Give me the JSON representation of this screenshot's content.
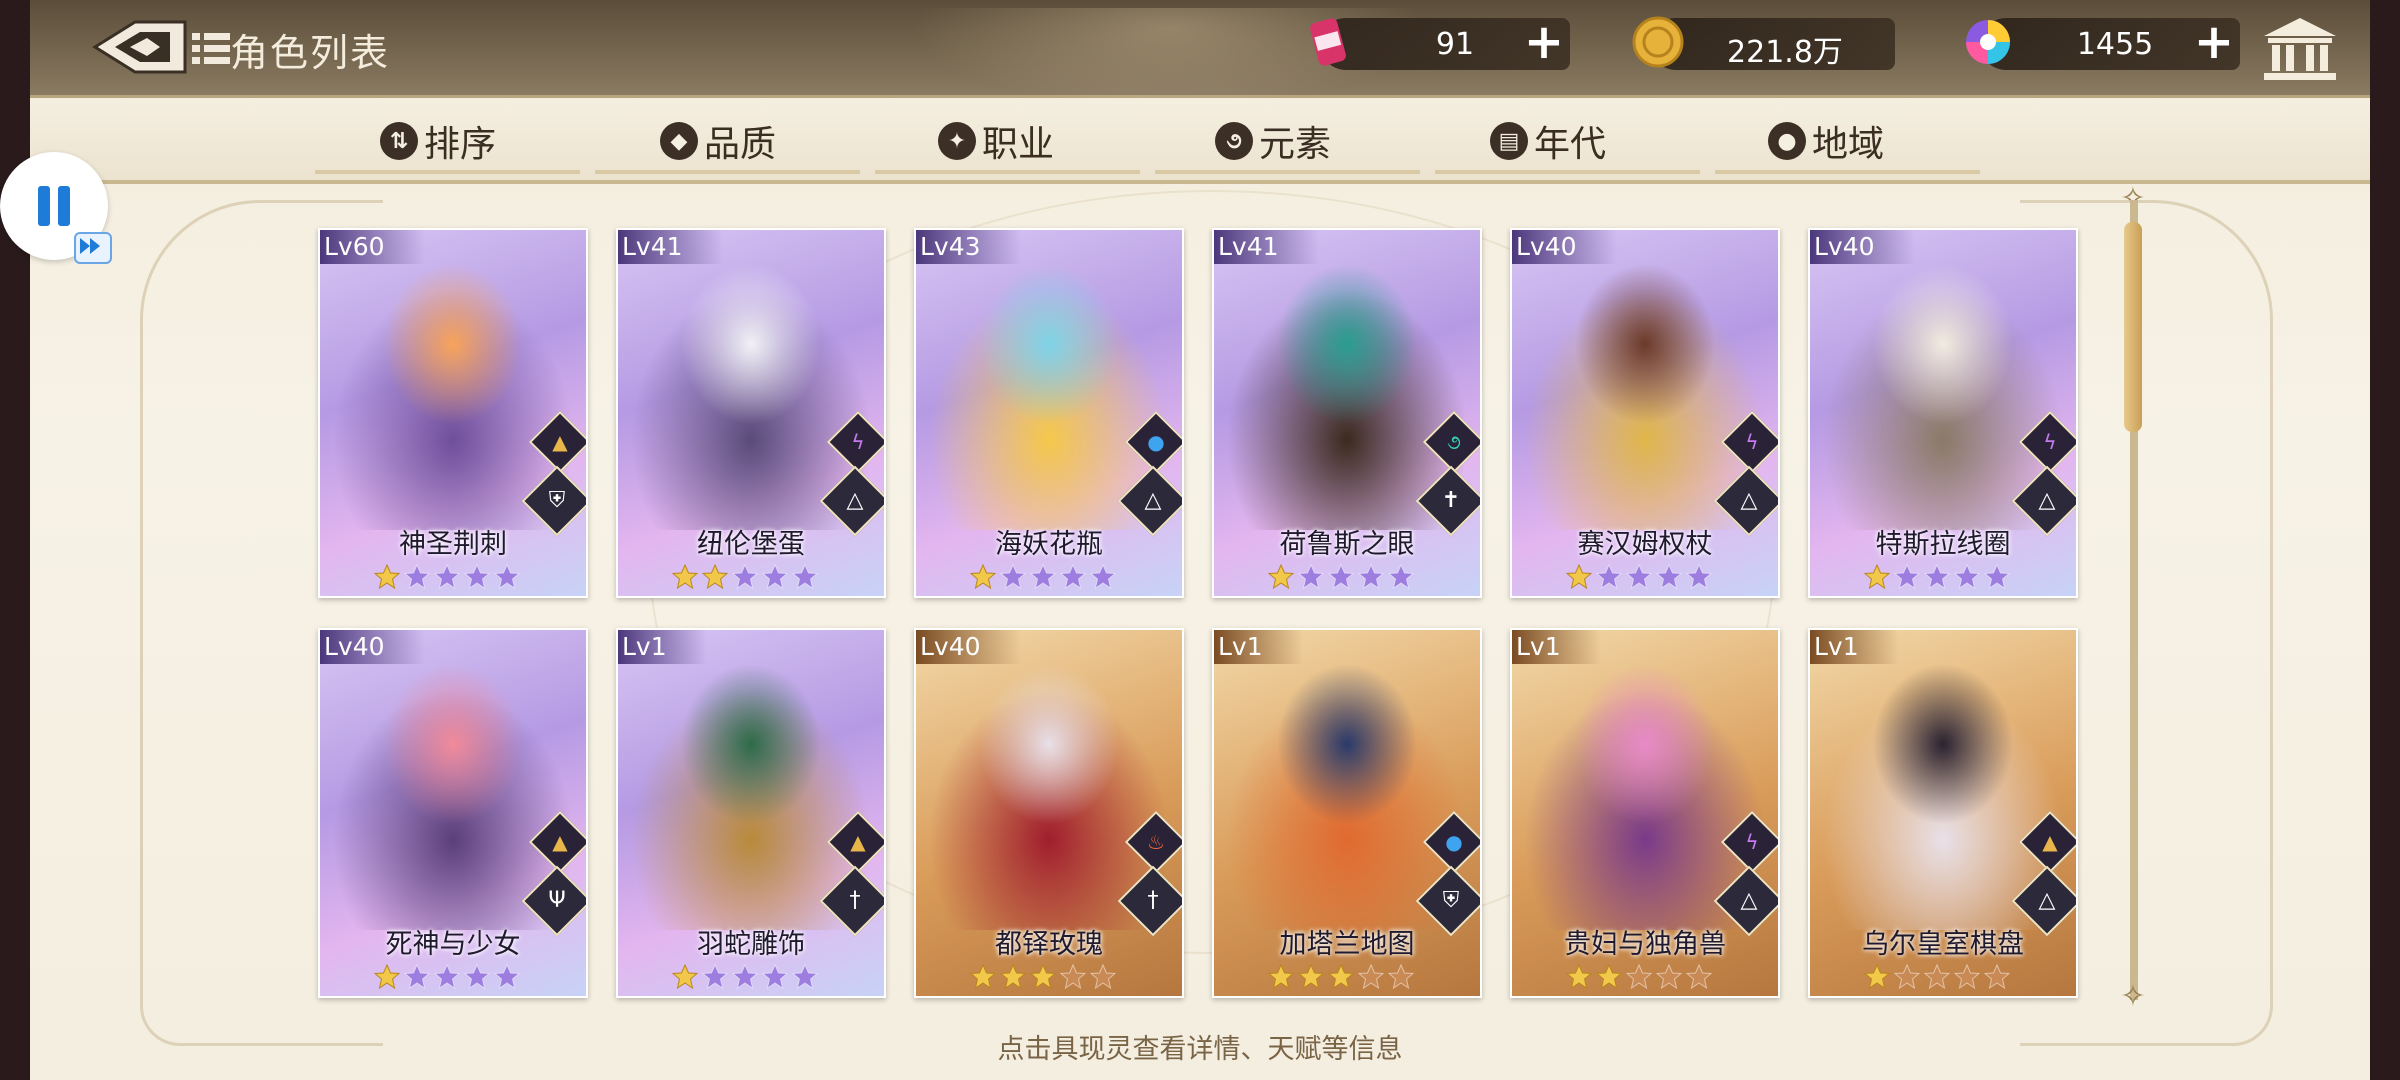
{
  "header": {
    "title": "角色列表",
    "resources": [
      {
        "icon": "energy-can-icon",
        "value": "91"
      },
      {
        "icon": "gold-coin-icon",
        "value": "221.8万"
      },
      {
        "icon": "rainbow-gem-icon",
        "value": "1455"
      }
    ]
  },
  "tabs": [
    {
      "label": "排序",
      "icon": "sort-icon"
    },
    {
      "label": "品质",
      "icon": "quality-icon"
    },
    {
      "label": "职业",
      "icon": "class-icon"
    },
    {
      "label": "元素",
      "icon": "element-icon"
    },
    {
      "label": "年代",
      "icon": "era-icon"
    },
    {
      "label": "地域",
      "icon": "region-icon"
    }
  ],
  "cards": [
    {
      "level": "Lv60",
      "name": "神圣荆刺",
      "stars": 1,
      "rarity": "purple",
      "element": "earth-icon",
      "role": "shield-icon"
    },
    {
      "level": "Lv41",
      "name": "纽伦堡蛋",
      "stars": 2,
      "rarity": "purple",
      "element": "lightning-icon",
      "role": "book-icon"
    },
    {
      "level": "Lv43",
      "name": "海妖花瓶",
      "stars": 1,
      "rarity": "purple",
      "element": "water-icon",
      "role": "book-icon"
    },
    {
      "level": "Lv41",
      "name": "荷鲁斯之眼",
      "stars": 1,
      "rarity": "purple",
      "element": "wind-icon",
      "role": "cross-icon"
    },
    {
      "level": "Lv40",
      "name": "赛汉姆权杖",
      "stars": 1,
      "rarity": "purple",
      "element": "lightning-icon",
      "role": "book-icon"
    },
    {
      "level": "Lv40",
      "name": "特斯拉线圈",
      "stars": 1,
      "rarity": "purple",
      "element": "lightning-icon",
      "role": "book-icon"
    },
    {
      "level": "Lv40",
      "name": "死神与少女",
      "stars": 1,
      "rarity": "purple",
      "element": "earth-icon",
      "role": "trident-icon"
    },
    {
      "level": "Lv1",
      "name": "羽蛇雕饰",
      "stars": 1,
      "rarity": "purple",
      "element": "earth-icon",
      "role": "sword-icon"
    },
    {
      "level": "Lv40",
      "name": "都铎玫瑰",
      "stars": 3,
      "rarity": "gold",
      "element": "fire-icon",
      "role": "sword-icon"
    },
    {
      "level": "Lv1",
      "name": "加塔兰地图",
      "stars": 3,
      "rarity": "gold",
      "element": "water-icon",
      "role": "shield-icon"
    },
    {
      "level": "Lv1",
      "name": "贵妇与独角兽",
      "stars": 2,
      "rarity": "gold",
      "element": "lightning-icon",
      "role": "book-icon"
    },
    {
      "level": "Lv1",
      "name": "乌尔皇室棋盘",
      "stars": 1,
      "rarity": "gold",
      "element": "earth-icon",
      "role": "book-icon"
    }
  ],
  "footer_hint": "点击具现灵查看详情、天赋等信息",
  "colors": {
    "star_filled": "#f2c84b",
    "star_empty_purple": "#9d7ee0",
    "star_empty_gold": "#c98a55",
    "accent_blue": "#1e7bd8"
  }
}
